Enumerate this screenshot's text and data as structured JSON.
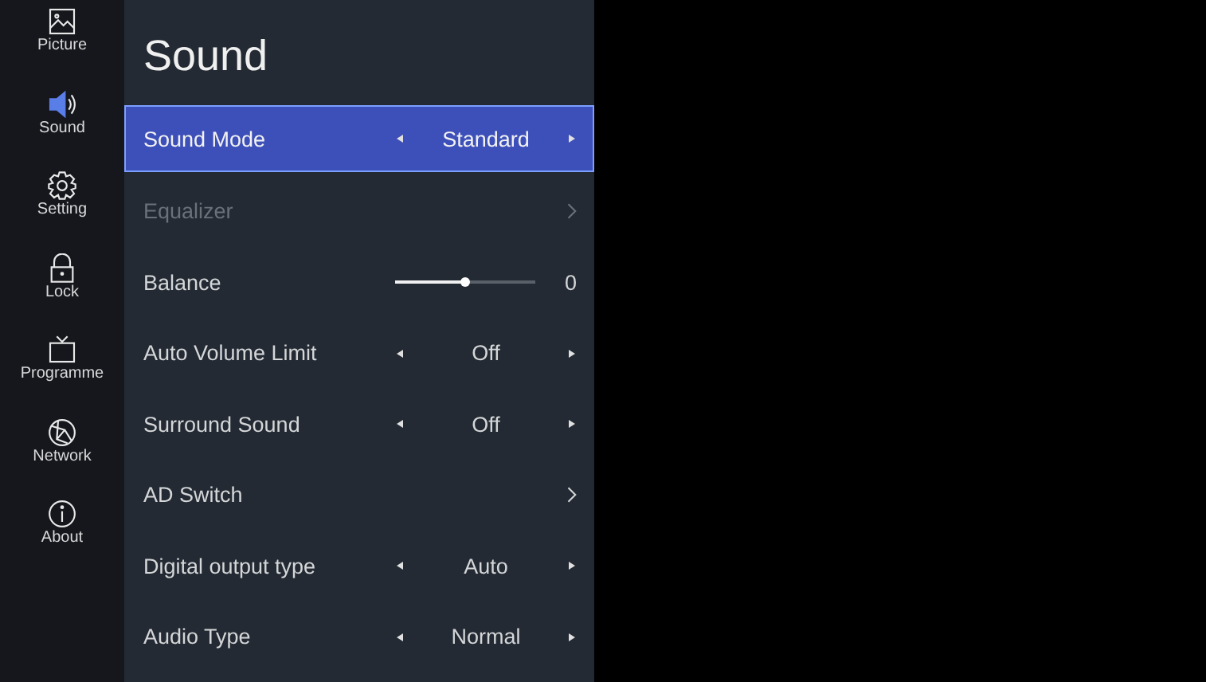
{
  "sidebar": {
    "items": [
      {
        "label": "Picture",
        "selected": false
      },
      {
        "label": "Sound",
        "selected": true
      },
      {
        "label": "Setting",
        "selected": false
      },
      {
        "label": "Lock",
        "selected": false
      },
      {
        "label": "Programme",
        "selected": false
      },
      {
        "label": "Network",
        "selected": false
      },
      {
        "label": "About",
        "selected": false
      }
    ]
  },
  "panel": {
    "title": "Sound",
    "items": [
      {
        "kind": "select",
        "label": "Sound Mode",
        "value": "Standard",
        "selected": true,
        "disabled": false
      },
      {
        "kind": "link",
        "label": "Equalizer",
        "selected": false,
        "disabled": true
      },
      {
        "kind": "slider",
        "label": "Balance",
        "value": "0",
        "level": 0.5,
        "selected": false,
        "disabled": false
      },
      {
        "kind": "select",
        "label": "Auto Volume Limit",
        "value": "Off",
        "selected": false,
        "disabled": false
      },
      {
        "kind": "select",
        "label": "Surround Sound",
        "value": "Off",
        "selected": false,
        "disabled": false
      },
      {
        "kind": "link",
        "label": "AD Switch",
        "selected": false,
        "disabled": false
      },
      {
        "kind": "select",
        "label": "Digital output type",
        "value": "Auto",
        "selected": false,
        "disabled": false
      },
      {
        "kind": "select",
        "label": "Audio Type",
        "value": "Normal",
        "selected": false,
        "disabled": false
      }
    ]
  }
}
